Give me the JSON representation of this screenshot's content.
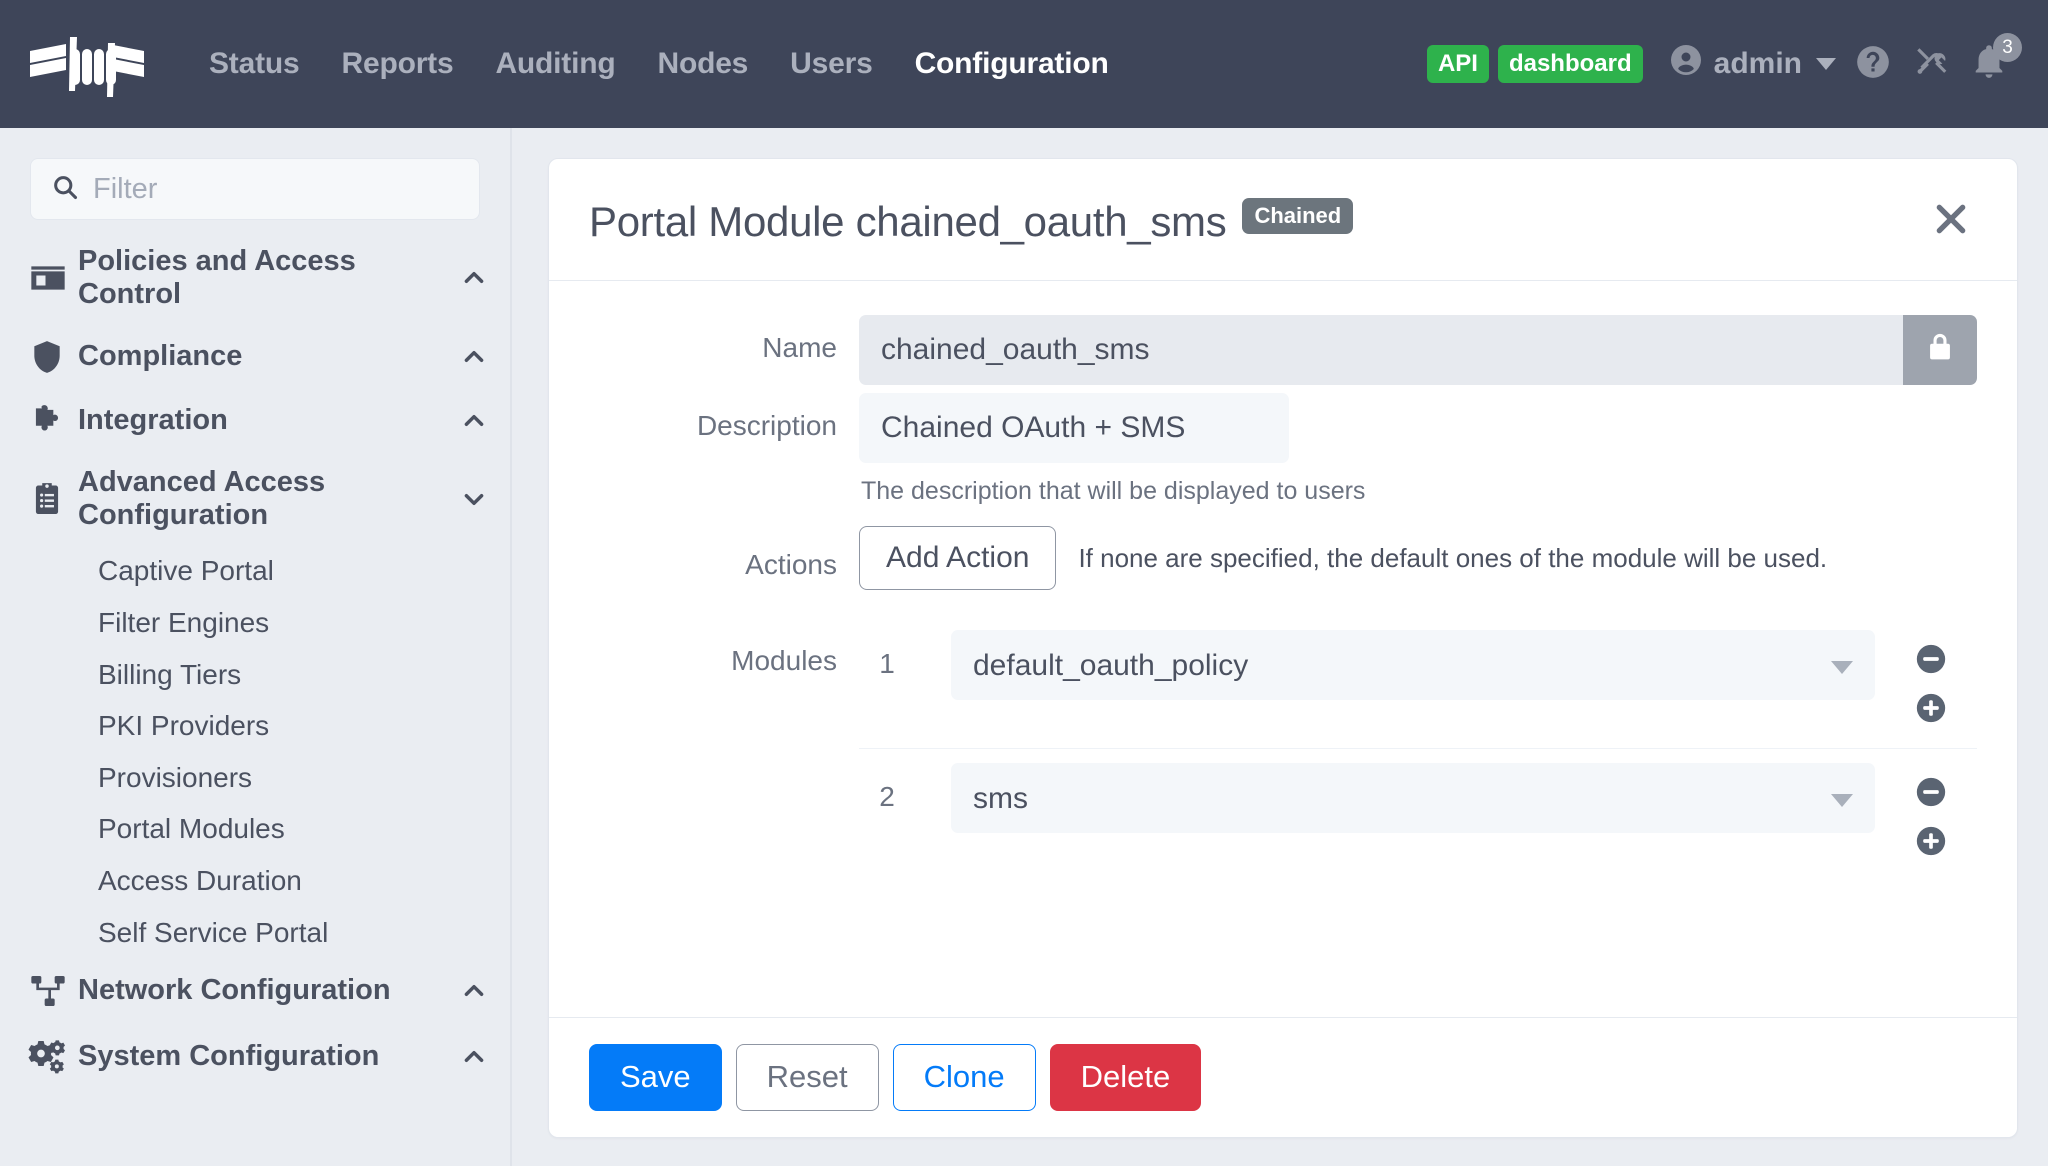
{
  "topnav": {
    "logo_name": "packetfence-logo",
    "links": [
      {
        "label": "Status",
        "active": false
      },
      {
        "label": "Reports",
        "active": false
      },
      {
        "label": "Auditing",
        "active": false
      },
      {
        "label": "Nodes",
        "active": false
      },
      {
        "label": "Users",
        "active": false
      },
      {
        "label": "Configuration",
        "active": true
      }
    ],
    "api_pill": "API",
    "dashboard_pill": "dashboard",
    "pill_color": "#2eb24c",
    "user": "admin",
    "help_icon": "question-circle-icon",
    "tools_icon": "tools-icon",
    "notifications_icon": "bell-icon",
    "notifications_count": "3",
    "bg_color": "#3e4559"
  },
  "sidebar": {
    "filter": {
      "value": "",
      "placeholder": "Filter",
      "icon": "search-icon"
    },
    "sections": [
      {
        "label": "Policies and Access Control",
        "icon": "id-card-icon",
        "chevron": "up",
        "items": []
      },
      {
        "label": "Compliance",
        "icon": "shield-icon",
        "chevron": "up",
        "items": []
      },
      {
        "label": "Integration",
        "icon": "puzzle-piece-icon",
        "chevron": "up",
        "items": []
      },
      {
        "label": "Advanced Access Configuration",
        "icon": "clipboard-list-icon",
        "chevron": "down",
        "items": [
          "Captive Portal",
          "Filter Engines",
          "Billing Tiers",
          "PKI Providers",
          "Provisioners",
          "Portal Modules",
          "Access Duration",
          "Self Service Portal"
        ]
      },
      {
        "label": "Network Configuration",
        "icon": "sitemap-icon",
        "chevron": "up",
        "items": []
      },
      {
        "label": "System Configuration",
        "icon": "cogs-icon",
        "chevron": "up",
        "items": []
      }
    ]
  },
  "panel": {
    "title": "Portal Module chained_oauth_sms",
    "badge": "Chained",
    "badge_color": "#6c757d",
    "close_icon": "close-icon",
    "fields": {
      "name": {
        "label": "Name",
        "value": "chained_oauth_sms",
        "locked": true,
        "lock_icon": "lock-icon"
      },
      "description": {
        "label": "Description",
        "value": "Chained OAuth + SMS",
        "help": "The description that will be displayed to users"
      },
      "actions": {
        "label": "Actions",
        "button_label": "Add Action",
        "note": "If none are specified, the default ones of the module will be used."
      },
      "modules": {
        "label": "Modules",
        "rows": [
          {
            "index": "1",
            "value": "default_oauth_policy",
            "remove_icon": "minus-circle-icon",
            "add_icon": "plus-circle-icon"
          },
          {
            "index": "2",
            "value": "sms",
            "remove_icon": "minus-circle-icon",
            "add_icon": "plus-circle-icon"
          }
        ]
      }
    },
    "footer": {
      "save": "Save",
      "reset": "Reset",
      "clone": "Clone",
      "delete": "Delete",
      "save_color": "#047bf8",
      "delete_color": "#dc3545"
    }
  }
}
